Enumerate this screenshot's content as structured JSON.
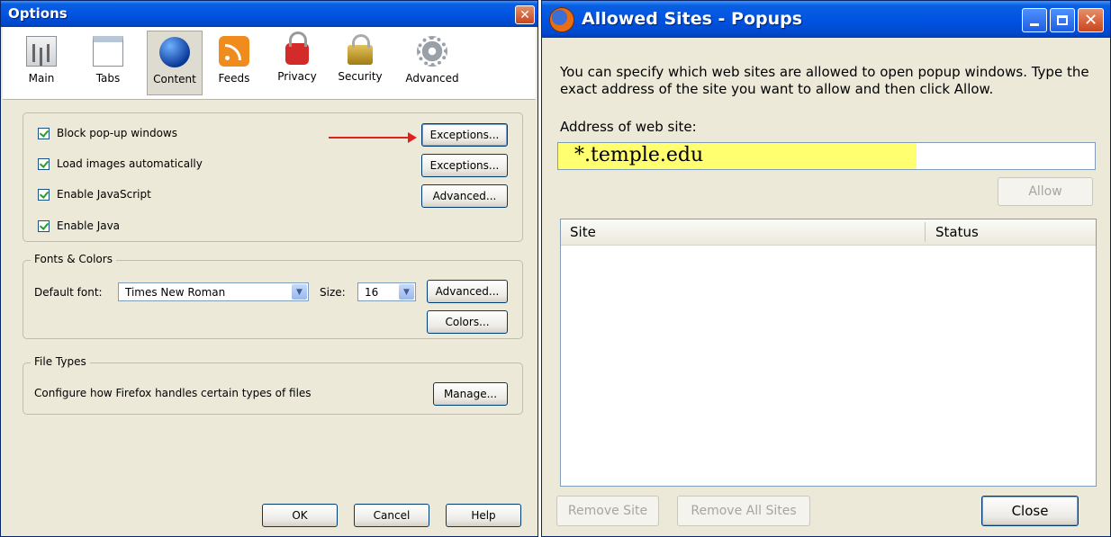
{
  "options": {
    "title": "Options",
    "toolbar": [
      {
        "label": "Main",
        "icon": "main-icon"
      },
      {
        "label": "Tabs",
        "icon": "tabs-icon"
      },
      {
        "label": "Content",
        "icon": "content-icon",
        "selected": true
      },
      {
        "label": "Feeds",
        "icon": "feeds-icon"
      },
      {
        "label": "Privacy",
        "icon": "privacy-icon"
      },
      {
        "label": "Security",
        "icon": "security-icon"
      },
      {
        "label": "Advanced",
        "icon": "advanced-icon"
      }
    ],
    "content": {
      "checkboxes": [
        {
          "label": "Block pop-up windows",
          "checked": true
        },
        {
          "label": "Load images automatically",
          "checked": true
        },
        {
          "label": "Enable JavaScript",
          "checked": true
        },
        {
          "label": "Enable Java",
          "checked": true
        }
      ],
      "popup_exceptions_label": "Exceptions...",
      "images_exceptions_label": "Exceptions...",
      "js_advanced_label": "Advanced..."
    },
    "fonts": {
      "caption": "Fonts & Colors",
      "default_font_label": "Default font:",
      "default_font_value": "Times New Roman",
      "size_label": "Size:",
      "size_value": "16",
      "advanced_label": "Advanced...",
      "colors_label": "Colors..."
    },
    "file_types": {
      "caption": "File Types",
      "description": "Configure how Firefox handles certain types of files",
      "manage_label": "Manage..."
    },
    "buttons": {
      "ok": "OK",
      "cancel": "Cancel",
      "help": "Help"
    }
  },
  "allowed_sites": {
    "title": "Allowed Sites - Popups",
    "description": "You can specify which web sites are allowed to open popup windows. Type the exact address of the site you want to allow and then click Allow.",
    "address_label": "Address of web site:",
    "address_value": "*.temple.edu",
    "allow_label": "Allow",
    "columns": [
      "Site",
      "Status"
    ],
    "sites": [],
    "remove_site_label": "Remove Site",
    "remove_all_label": "Remove All Sites",
    "close_label": "Close"
  },
  "colors": {
    "title_bar": "#0054e3",
    "dialog_bg": "#ece9d8",
    "highlight": "#ffff70",
    "arrow": "#e02020"
  }
}
